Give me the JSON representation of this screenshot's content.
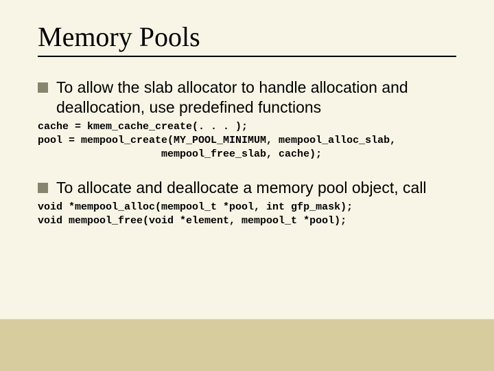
{
  "title": "Memory Pools",
  "bullets": [
    {
      "text": "To allow the slab allocator to handle allocation and deallocation, use predefined functions",
      "code": "cache = kmem_cache_create(. . . );\npool = mempool_create(MY_POOL_MINIMUM, mempool_alloc_slab,\n                    mempool_free_slab, cache);"
    },
    {
      "text": "To allocate and deallocate a memory pool object, call",
      "code": "void *mempool_alloc(mempool_t *pool, int gfp_mask);\nvoid mempool_free(void *element, mempool_t *pool);"
    }
  ]
}
